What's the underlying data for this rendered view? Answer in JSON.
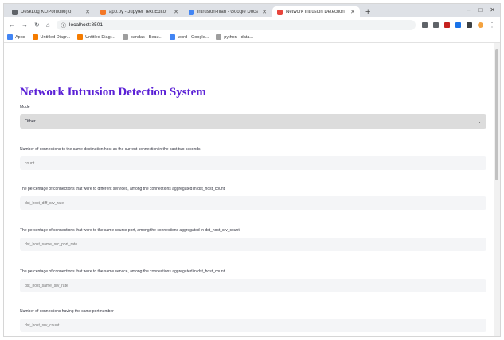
{
  "browser": {
    "tabs": [
      {
        "label": "DeskLog KL/Portfolio(Io)",
        "favicon_color": "#5f6368",
        "active": false
      },
      {
        "label": "app.py - Jupyter Text Editor",
        "favicon_color": "#f37726",
        "active": false
      },
      {
        "label": "intrusion-nlan - Google Docs",
        "favicon_color": "#4285f4",
        "active": false
      },
      {
        "label": "Network Intrusion Detection",
        "favicon_color": "#e8453c",
        "active": true
      }
    ],
    "new_tab": "+",
    "window_controls": {
      "minimize": "–",
      "maximize": "□",
      "close": "✕"
    },
    "nav": {
      "back": "←",
      "forward": "→",
      "reload": "↻",
      "home": "⌂"
    },
    "address": "localhost:8501",
    "extensions": [
      {
        "name": "puzzle-icon",
        "color": "#5f6368"
      },
      {
        "name": "star-icon",
        "color": "#5f6368"
      },
      {
        "name": "extension-red-icon",
        "color": "#c5221f"
      },
      {
        "name": "extension-blue-icon",
        "color": "#1a73e8"
      },
      {
        "name": "extension-dark-icon",
        "color": "#3c4043"
      },
      {
        "name": "profile-icon",
        "color": "#f4a340"
      }
    ],
    "bookmarks": [
      {
        "label": "Apps",
        "color": "#4285f4"
      },
      {
        "label": "Untitled Diagr...",
        "color": "#f57c00"
      },
      {
        "label": "Untitled Diagr...",
        "color": "#f57c00"
      },
      {
        "label": "pandas - Beau...",
        "color": "#9e9e9e"
      },
      {
        "label": "word - Google...",
        "color": "#4285f4"
      },
      {
        "label": "python - data...",
        "color": "#9e9e9e"
      }
    ]
  },
  "page": {
    "title": "Network Intrusion Detection System",
    "mode_label": "Mode",
    "mode_value": "Other",
    "fields": [
      {
        "label": "Number of connections to the same destination host as the current connection in the past two seconds",
        "placeholder": "count"
      },
      {
        "label": "The percentage of connections that were to different services, among the connections aggregated in dst_host_count",
        "placeholder": "dst_host_diff_srv_rate"
      },
      {
        "label": "The percentage of connections that were to the same source port, among the connections aggregated in dst_host_srv_count",
        "placeholder": "dst_host_same_src_port_rate"
      },
      {
        "label": "The percentage of connections that were to the same service, among the connections aggregated in dst_host_count",
        "placeholder": "dst_host_same_srv_rate"
      },
      {
        "label": "Number of connections having the same port number",
        "placeholder": "dst_host_srv_count"
      }
    ]
  }
}
